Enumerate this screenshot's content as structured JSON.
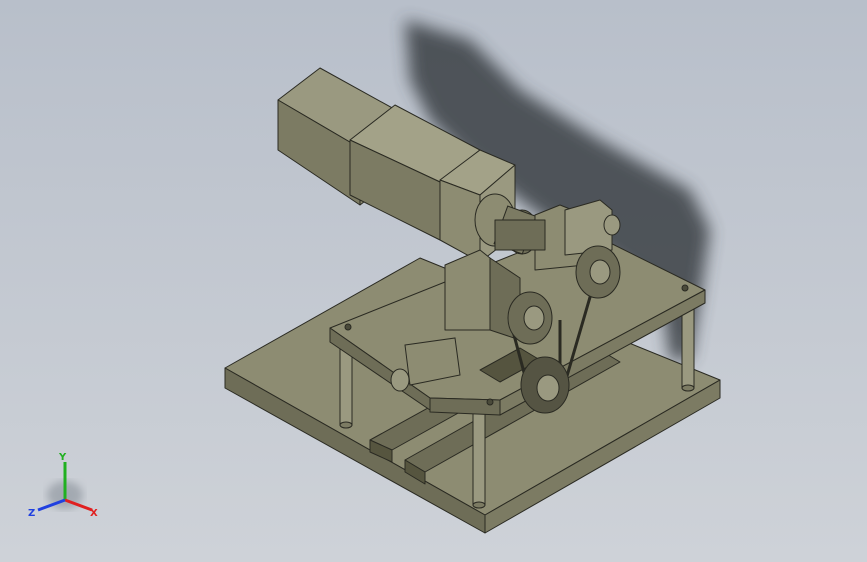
{
  "viewport": {
    "background_top": "#b8bfca",
    "background_bottom": "#ced2d8"
  },
  "model": {
    "body_color": "#8d8c72",
    "body_light": "#a3a288",
    "body_dark": "#6e6d57",
    "edge_color": "#2a2a22",
    "shadow_color": "#3a3f45"
  },
  "triad": {
    "x_label": "X",
    "y_label": "Y",
    "z_label": "Z",
    "x_color": "#e02020",
    "y_color": "#20b020",
    "z_color": "#2040e0"
  }
}
